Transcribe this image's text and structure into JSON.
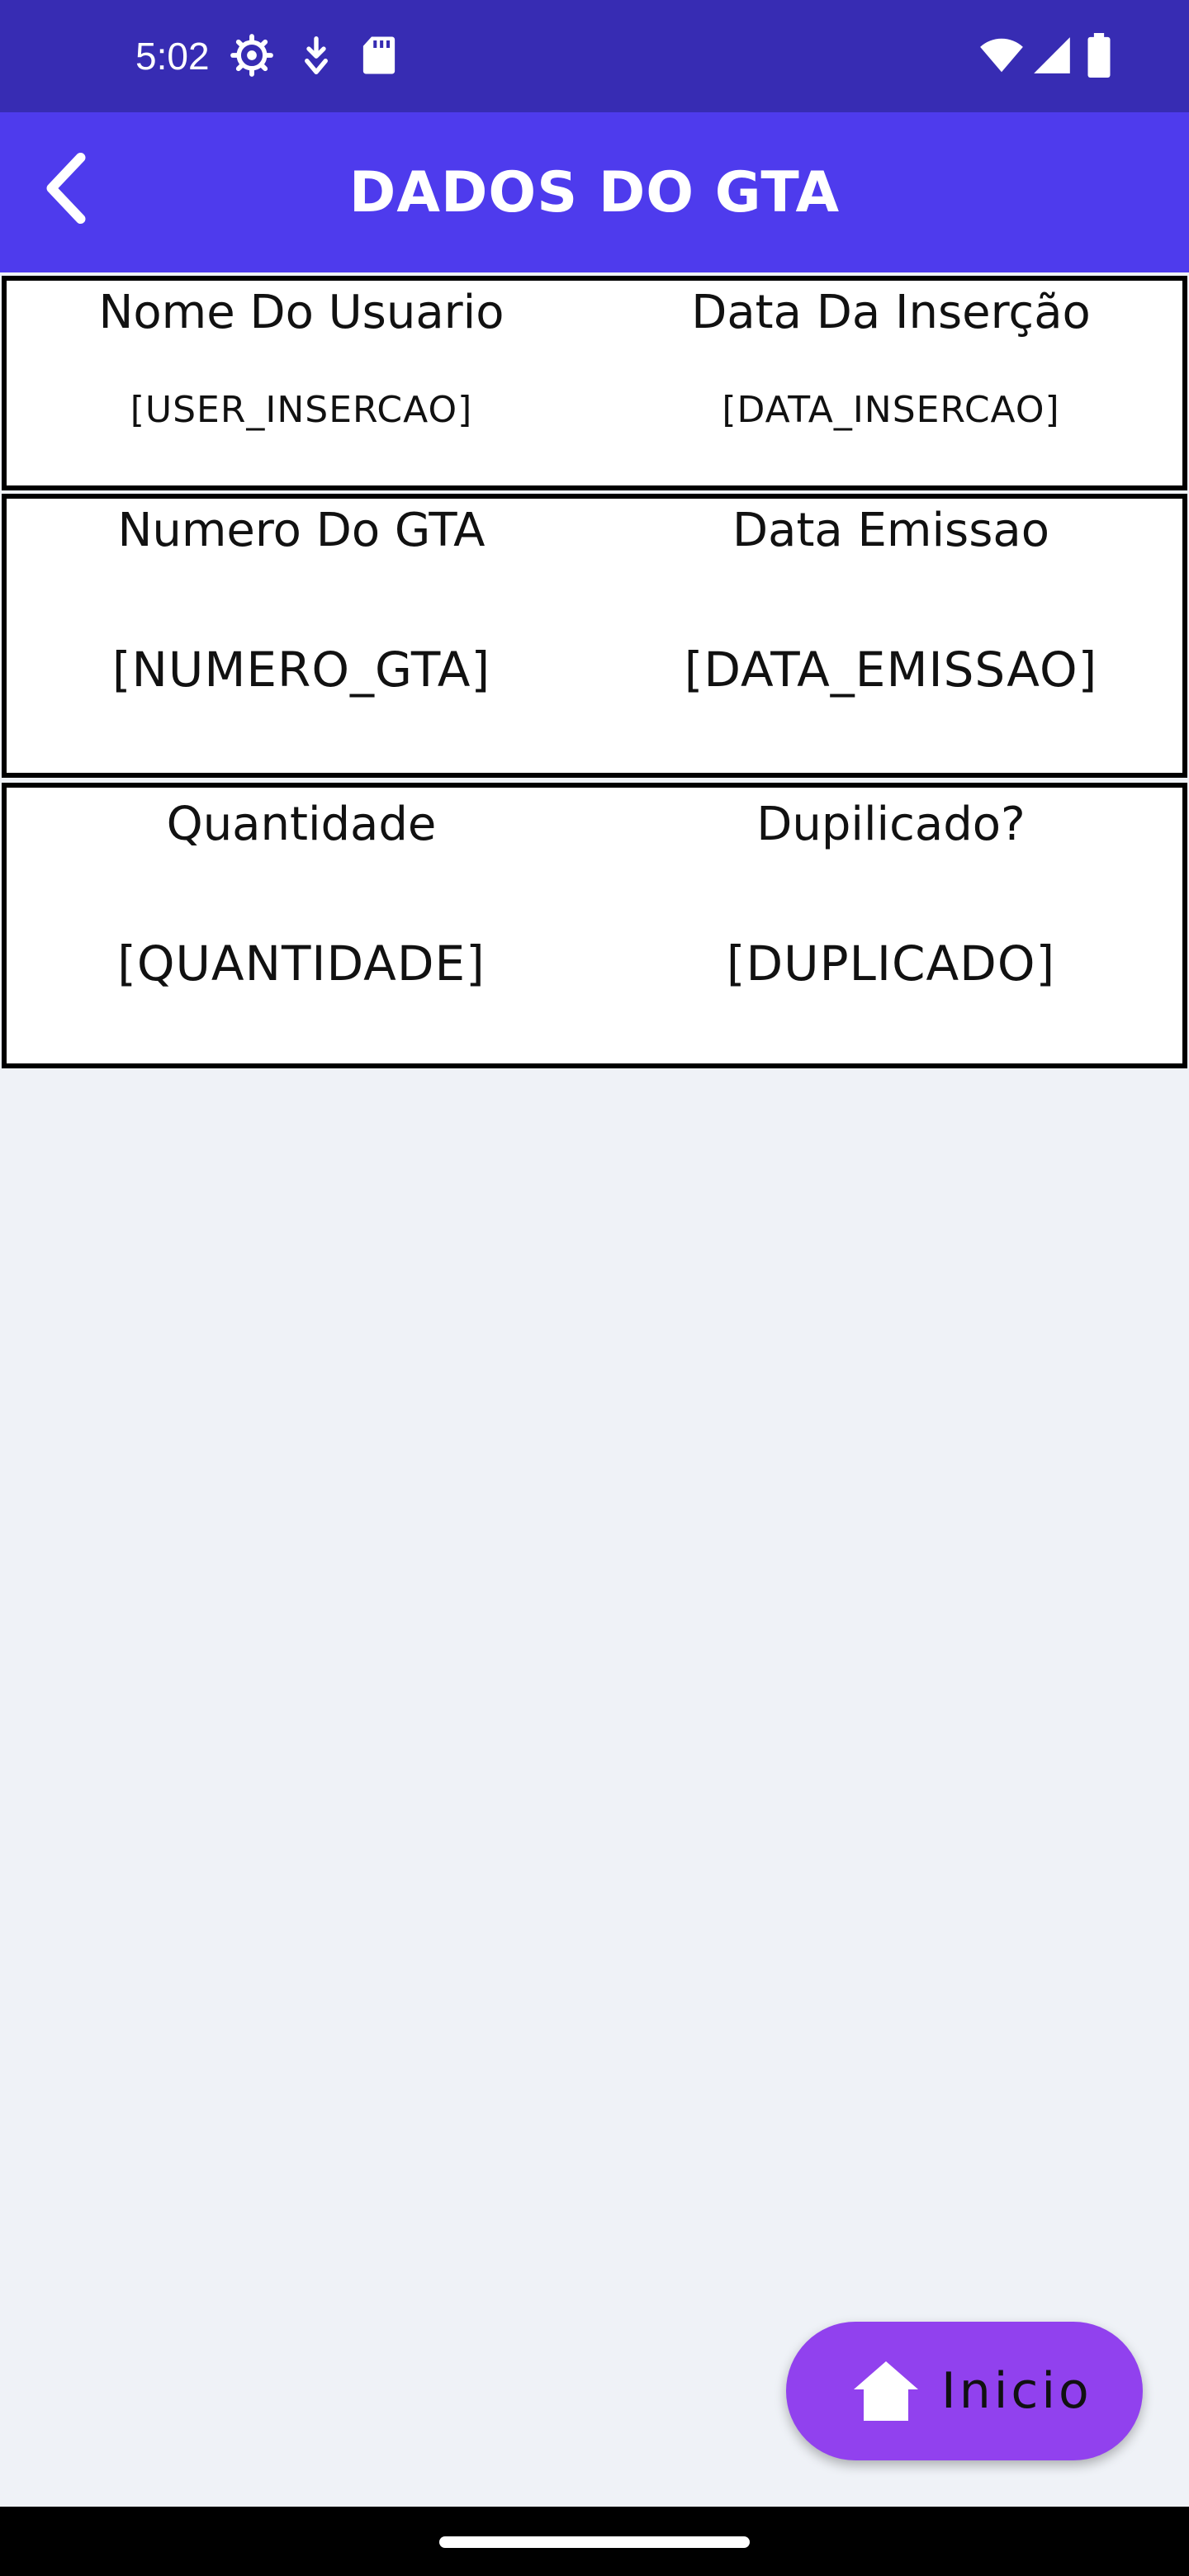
{
  "status_bar": {
    "time": "5:02",
    "icons": [
      "gear-icon",
      "download-icon",
      "sd-card-icon",
      "wifi-icon",
      "cellular-signal-icon",
      "battery-icon"
    ]
  },
  "app_bar": {
    "title": "DADOS DO GTA",
    "back_icon": "chevron-left-icon"
  },
  "cards": {
    "row1": {
      "left_label": "Nome Do Usuario",
      "left_value": "[USER_INSERCAO]",
      "right_label": "Data Da Inserção",
      "right_value": "[DATA_INSERCAO]"
    },
    "row2": {
      "left_label": "Numero Do GTA",
      "left_value": "[NUMERO_GTA]",
      "right_label": "Data Emissao",
      "right_value": "[DATA_EMISSAO]"
    },
    "row3": {
      "left_label": "Quantidade",
      "left_value": "[QUANTIDADE]",
      "right_label": "Dupilicado?",
      "right_value": "[DUPLICADO]"
    }
  },
  "fab": {
    "label": "Inicio",
    "icon": "home-icon"
  },
  "colors": {
    "status_bar": "#372cb3",
    "app_bar": "#4e3bed",
    "fab": "#9141ee",
    "background": "#eff2f7",
    "card_border": "#000000"
  }
}
